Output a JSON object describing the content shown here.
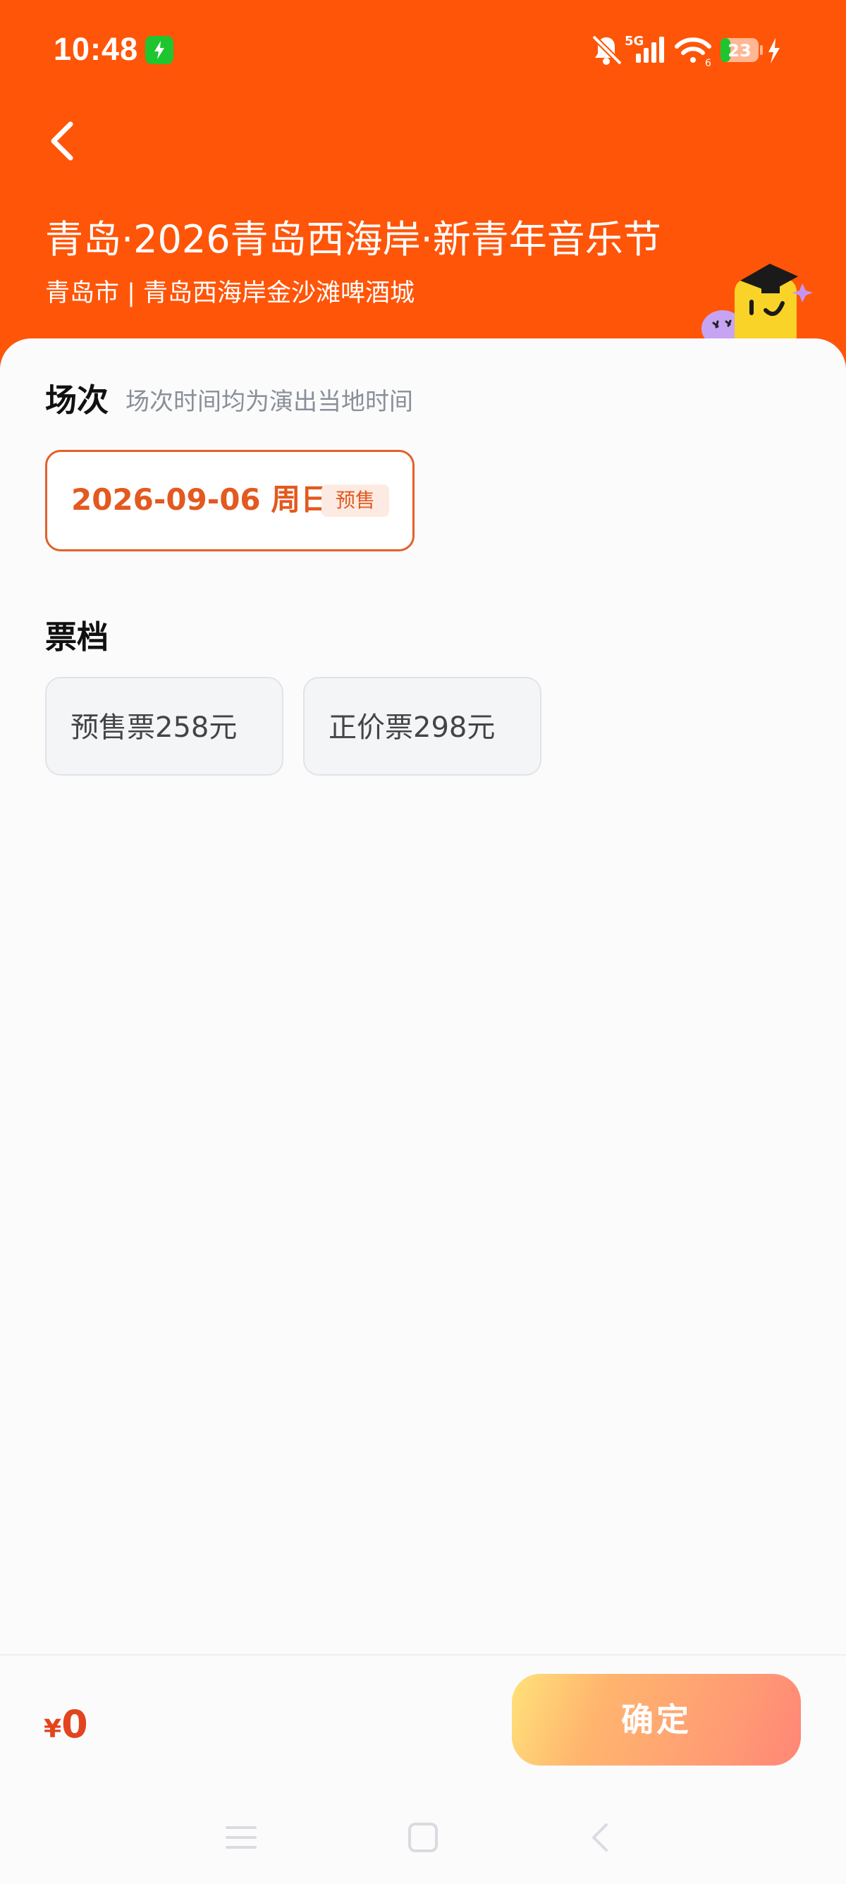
{
  "status_bar": {
    "time": "10:48",
    "network": "5G",
    "battery": "23",
    "icons": [
      "charging-icon",
      "mute-bell-icon",
      "signal-icon",
      "wifi-icon",
      "battery-icon",
      "bolt-icon"
    ]
  },
  "header": {
    "title": "青岛·2026青岛西海岸·新青年音乐节",
    "venue": "青岛市 | 青岛西海岸金沙滩啤酒城",
    "accent_color": "#ff5509"
  },
  "session": {
    "title": "场次",
    "hint": "场次时间均为演出当地时间",
    "date": "2026-09-06 周日",
    "badge": "预售",
    "selected_color": "#e3591f"
  },
  "tickets": {
    "title": "票档",
    "items": [
      {
        "label": "预售票258元"
      },
      {
        "label": "正价票298元"
      }
    ]
  },
  "footer": {
    "currency": "¥",
    "total": "0",
    "confirm_label": "确定"
  },
  "nav": {
    "icons": [
      "menu-icon",
      "home-icon",
      "back-icon"
    ]
  }
}
